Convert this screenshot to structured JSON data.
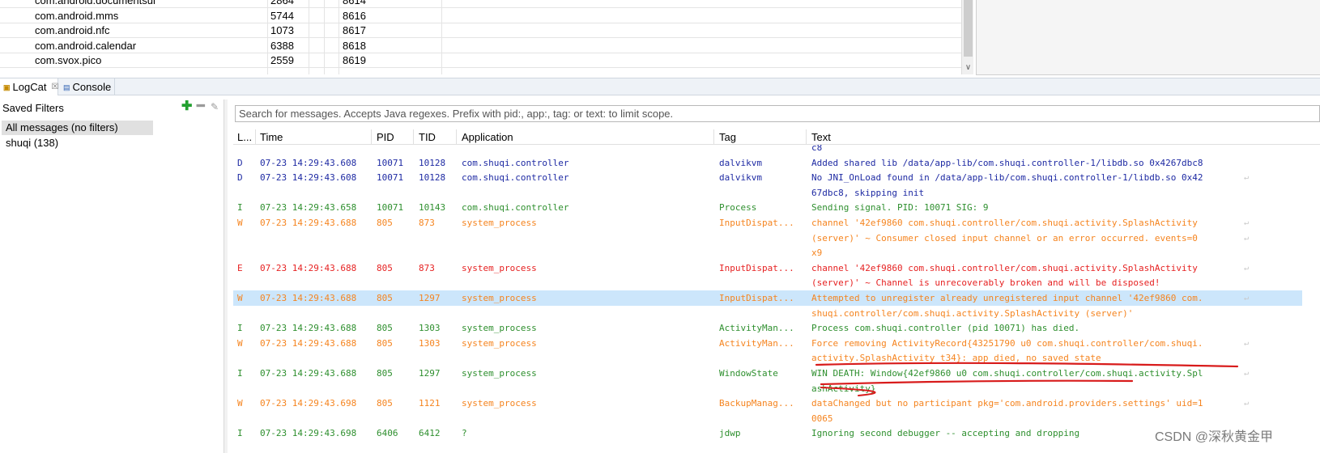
{
  "process_table": {
    "rows": [
      {
        "name": "com.android.documentsui",
        "pid": "2864",
        "port": "8614"
      },
      {
        "name": "com.android.mms",
        "pid": "5744",
        "port": "8616"
      },
      {
        "name": "com.android.nfc",
        "pid": "1073",
        "port": "8617"
      },
      {
        "name": "com.android.calendar",
        "pid": "6388",
        "port": "8618"
      },
      {
        "name": "com.svox.pico",
        "pid": "2559",
        "port": "8619"
      }
    ]
  },
  "tabs": [
    {
      "label": "LogCat",
      "icon": "logcat-icon",
      "close": "☒"
    },
    {
      "label": "Console",
      "icon": "console-icon"
    }
  ],
  "saved_filters": {
    "title": "Saved Filters",
    "add_icon": "✚",
    "remove_icon": "━",
    "edit_icon": "✎",
    "items": [
      {
        "label": "All messages (no filters)",
        "selected": true
      },
      {
        "label": "shuqi (138)",
        "selected": false
      }
    ]
  },
  "search": {
    "placeholder": "Search for messages. Accepts Java regexes. Prefix with pid:, app:, tag: or text: to limit scope."
  },
  "log_columns": [
    "L...",
    "Time",
    "PID",
    "TID",
    "Application",
    "Tag",
    "Text"
  ],
  "log_rows": [
    {
      "level": "",
      "time": "",
      "pid": "",
      "tid": "",
      "app": "",
      "tag": "",
      "text": "c8",
      "wrap": false
    },
    {
      "level": "D",
      "time": "07-23 14:29:43.608",
      "pid": "10071",
      "tid": "10128",
      "app": "com.shuqi.controller",
      "tag": "dalvikvm",
      "text": "Added shared lib /data/app-lib/com.shuqi.controller-1/libdb.so 0x4267dbc8",
      "wrap": false
    },
    {
      "level": "D",
      "time": "07-23 14:29:43.608",
      "pid": "10071",
      "tid": "10128",
      "app": "com.shuqi.controller",
      "tag": "dalvikvm",
      "text": "No JNI_OnLoad found in /data/app-lib/com.shuqi.controller-1/libdb.so 0x42",
      "wrap": true
    },
    {
      "level": "",
      "time": "",
      "pid": "",
      "tid": "",
      "app": "",
      "tag": "",
      "text": "67dbc8, skipping init",
      "wrap": false
    },
    {
      "level": "I",
      "time": "07-23 14:29:43.658",
      "pid": "10071",
      "tid": "10143",
      "app": "com.shuqi.controller",
      "tag": "Process",
      "text": "Sending signal. PID: 10071 SIG: 9",
      "wrap": false
    },
    {
      "level": "W",
      "time": "07-23 14:29:43.688",
      "pid": "805",
      "tid": "873",
      "app": "system_process",
      "tag": "InputDispat...",
      "text": "channel '42ef9860 com.shuqi.controller/com.shuqi.activity.SplashActivity",
      "wrap": true
    },
    {
      "level": "",
      "time": "",
      "pid": "",
      "tid": "",
      "app": "",
      "tag": "",
      "text": "(server)' ~ Consumer closed input channel or an error occurred.  events=0",
      "wrap": true
    },
    {
      "level": "",
      "time": "",
      "pid": "",
      "tid": "",
      "app": "",
      "tag": "",
      "text": "x9",
      "wrap": false
    },
    {
      "level": "E",
      "time": "07-23 14:29:43.688",
      "pid": "805",
      "tid": "873",
      "app": "system_process",
      "tag": "InputDispat...",
      "text": "channel '42ef9860 com.shuqi.controller/com.shuqi.activity.SplashActivity",
      "wrap": true
    },
    {
      "level": "",
      "time": "",
      "pid": "",
      "tid": "",
      "app": "",
      "tag": "",
      "text": "(server)' ~ Channel is unrecoverably broken and will be disposed!",
      "wrap": false
    },
    {
      "level": "W",
      "time": "07-23 14:29:43.688",
      "pid": "805",
      "tid": "1297",
      "app": "system_process",
      "tag": "InputDispat...",
      "text": "Attempted to unregister already unregistered input channel '42ef9860 com.",
      "wrap": true,
      "selected": true
    },
    {
      "level": "",
      "time": "",
      "pid": "",
      "tid": "",
      "app": "",
      "tag": "",
      "text": "shuqi.controller/com.shuqi.activity.SplashActivity (server)'",
      "wrap": false
    },
    {
      "level": "I",
      "time": "07-23 14:29:43.688",
      "pid": "805",
      "tid": "1303",
      "app": "system_process",
      "tag": "ActivityMan...",
      "text": "Process com.shuqi.controller (pid 10071) has died.",
      "wrap": false
    },
    {
      "level": "W",
      "time": "07-23 14:29:43.688",
      "pid": "805",
      "tid": "1303",
      "app": "system_process",
      "tag": "ActivityMan...",
      "text": "Force removing ActivityRecord{43251790 u0 com.shuqi.controller/com.shuqi.",
      "wrap": true
    },
    {
      "level": "",
      "time": "",
      "pid": "",
      "tid": "",
      "app": "",
      "tag": "",
      "text": "activity.SplashActivity t34}: app died, no saved state",
      "wrap": false
    },
    {
      "level": "I",
      "time": "07-23 14:29:43.688",
      "pid": "805",
      "tid": "1297",
      "app": "system_process",
      "tag": "WindowState",
      "text": "WIN DEATH: Window{42ef9860 u0 com.shuqi.controller/com.shuqi.activity.Spl",
      "wrap": true
    },
    {
      "level": "",
      "time": "",
      "pid": "",
      "tid": "",
      "app": "",
      "tag": "",
      "text": "ashActivity}",
      "wrap": false
    },
    {
      "level": "W",
      "time": "07-23 14:29:43.698",
      "pid": "805",
      "tid": "1121",
      "app": "system_process",
      "tag": "BackupManag...",
      "text": "dataChanged but no participant pkg='com.android.providers.settings' uid=1",
      "wrap": true
    },
    {
      "level": "",
      "time": "",
      "pid": "",
      "tid": "",
      "app": "",
      "tag": "",
      "text": "0065",
      "wrap": false
    },
    {
      "level": "I",
      "time": "07-23 14:29:43.698",
      "pid": "6406",
      "tid": "6412",
      "app": "?",
      "tag": "jdwp",
      "text": "Ignoring second debugger -- accepting and dropping",
      "wrap": false
    }
  ],
  "level_colors": {
    "D": "#1e2aa3",
    "I": "#2e8f2e",
    "W": "#f5841f",
    "E": "#e62222"
  },
  "annotation_color": "#d81b1b",
  "watermark": "CSDN @深秋黄金甲"
}
